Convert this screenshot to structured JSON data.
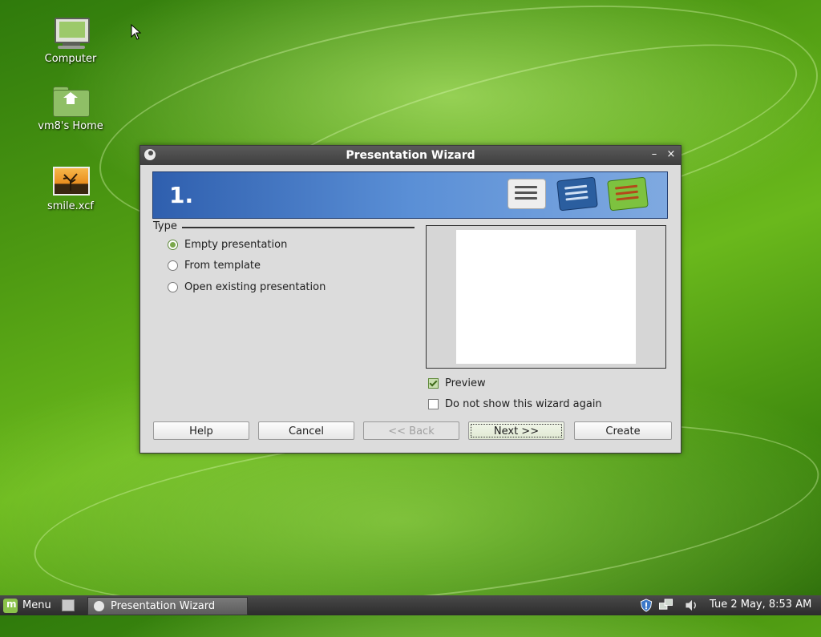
{
  "desktop": {
    "icons": [
      {
        "label": "Computer",
        "icon": "computer-icon"
      },
      {
        "label": "vm8's Home",
        "icon": "home-folder-icon"
      },
      {
        "label": "smile.xcf",
        "icon": "image-file-icon"
      }
    ]
  },
  "window": {
    "title": "Presentation Wizard",
    "minimize_glyph": "–",
    "close_glyph": "×",
    "step": "1.",
    "type_section": {
      "label": "Type",
      "options": [
        {
          "label": "Empty presentation",
          "checked": true
        },
        {
          "label": "From template",
          "checked": false
        },
        {
          "label": "Open existing presentation",
          "checked": false
        }
      ]
    },
    "preview_checkbox": {
      "label": "Preview",
      "checked": true
    },
    "dont_show_checkbox": {
      "label": "Do not show this wizard again",
      "checked": false
    },
    "buttons": {
      "help": "Help",
      "cancel": "Cancel",
      "back": "<< Back",
      "next": "Next >>",
      "create": "Create"
    }
  },
  "taskbar": {
    "menu_label": "Menu",
    "task_label": "Presentation Wizard",
    "clock": "Tue  2 May,  8:53 AM"
  },
  "colors": {
    "banner_start": "#2f5fae",
    "banner_end": "#7fa9e0",
    "radio_accent": "#7aa84a"
  }
}
